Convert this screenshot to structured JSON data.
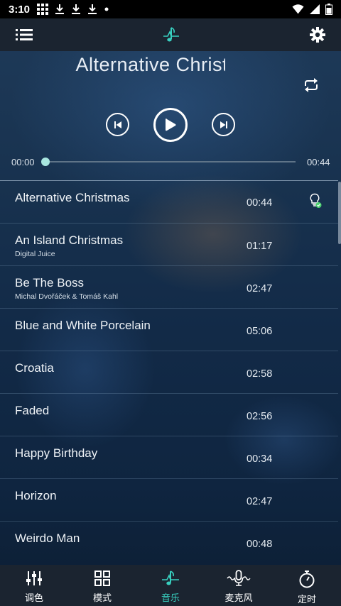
{
  "status_bar": {
    "time": "3:10"
  },
  "player": {
    "current_title": "Alternative Christmas",
    "position": "00:00",
    "duration": "00:44",
    "progress": 0.0
  },
  "playlist": [
    {
      "title": "Alternative Christmas",
      "artist": "",
      "duration": "00:44",
      "playing": true
    },
    {
      "title": "An Island Christmas",
      "artist": "Digital Juice",
      "duration": "01:17"
    },
    {
      "title": "Be The Boss",
      "artist": "Michal Dvořáček & Tomáš Kahl",
      "duration": "02:47"
    },
    {
      "title": "Blue and White Porcelain",
      "artist": "",
      "duration": "05:06"
    },
    {
      "title": "Croatia",
      "artist": "",
      "duration": "02:58"
    },
    {
      "title": "Faded",
      "artist": "",
      "duration": "02:56"
    },
    {
      "title": "Happy Birthday",
      "artist": "",
      "duration": "00:34"
    },
    {
      "title": "Horizon",
      "artist": "",
      "duration": "02:47"
    },
    {
      "title": "Weirdo Man",
      "artist": "",
      "duration": "00:48"
    }
  ],
  "bottom_nav": [
    {
      "label": "调色",
      "icon": "equalizer-sliders-icon"
    },
    {
      "label": "模式",
      "icon": "grid-icon"
    },
    {
      "label": "音乐",
      "icon": "music-note-icon",
      "active": true
    },
    {
      "label": "麦克风",
      "icon": "microphone-icon"
    },
    {
      "label": "定时",
      "icon": "timer-icon"
    }
  ],
  "colors": {
    "accent": "#38d0c0",
    "bar_bg": "#1b2430"
  }
}
